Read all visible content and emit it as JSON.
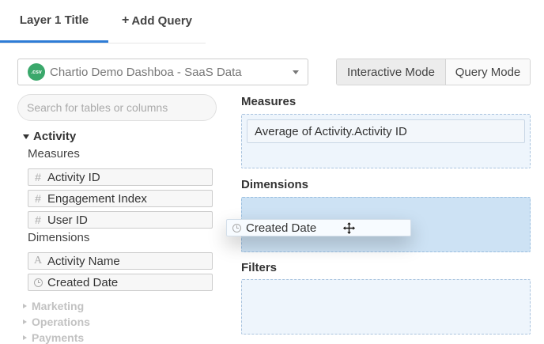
{
  "tabs": {
    "active_label": "Layer 1 Title",
    "add_label": "Add Query"
  },
  "datasource": {
    "badge": ".csv",
    "selected": "Chartio Demo Dashboa - SaaS Data"
  },
  "modes": {
    "interactive": "Interactive Mode",
    "query": "Query Mode"
  },
  "search": {
    "placeholder": "Search for tables or columns"
  },
  "tree": {
    "group": "Activity",
    "measures_label": "Measures",
    "measures": [
      "Activity ID",
      "Engagement Index",
      "User ID"
    ],
    "dimensions_label": "Dimensions",
    "dimensions": [
      "Activity Name",
      "Created Date"
    ],
    "collapsed_groups": [
      "Marketing",
      "Operations",
      "Payments"
    ]
  },
  "panel": {
    "measures_label": "Measures",
    "measure_pill": "Average of Activity.Activity ID",
    "dimensions_label": "Dimensions",
    "filters_label": "Filters"
  },
  "drag": {
    "label": "Created Date"
  },
  "colors": {
    "accent": "#2e7cd6",
    "csv_badge": "#3aa86b",
    "dropzone": "#eef5fc",
    "dropzone_hover": "#cde2f4"
  }
}
